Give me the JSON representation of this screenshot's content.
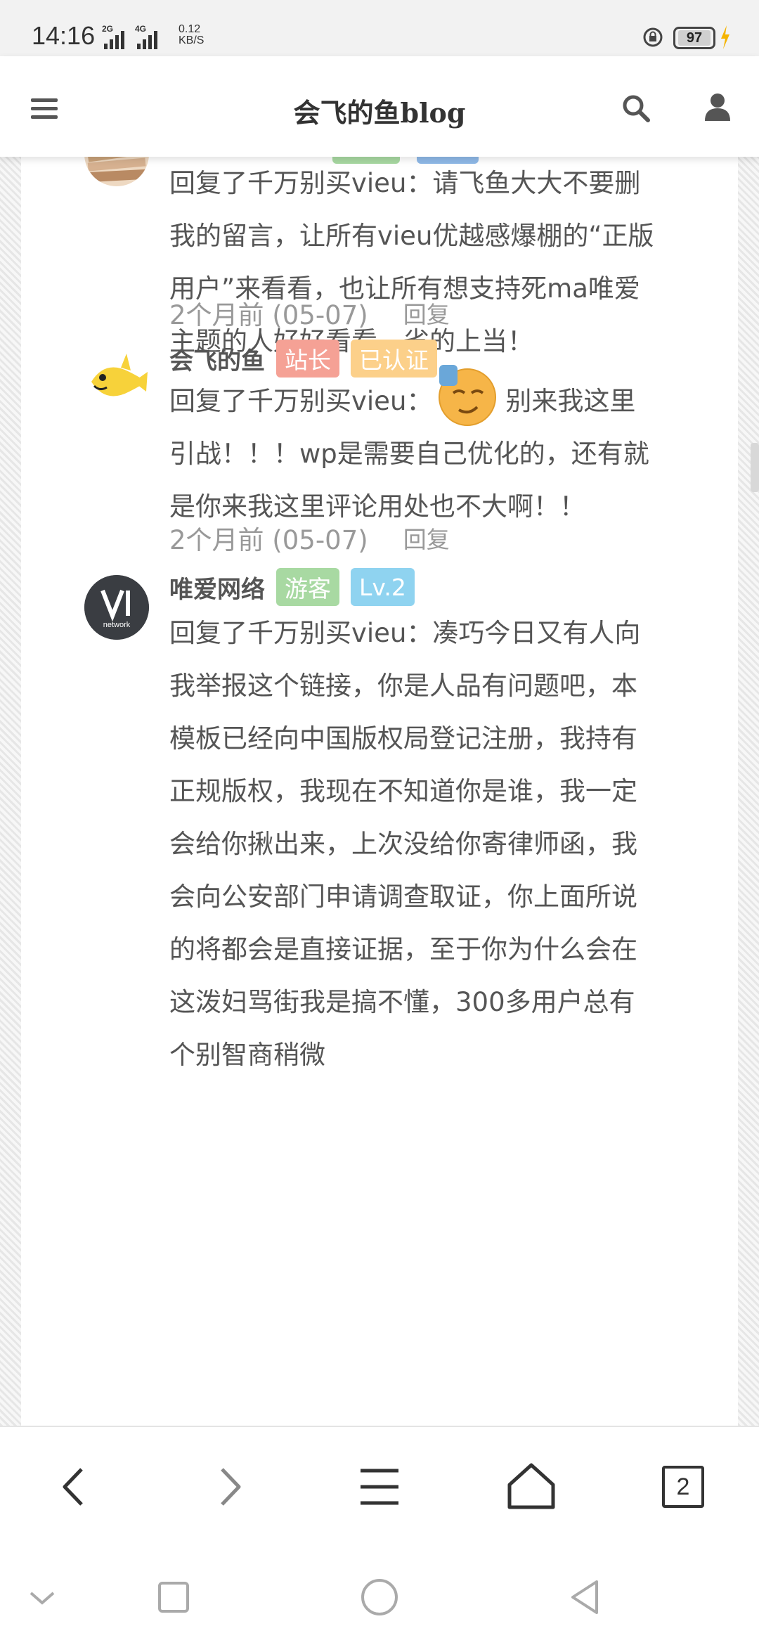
{
  "status_bar": {
    "time": "14:16",
    "net1": "2G",
    "net2": "4G",
    "speed_value": "0.12",
    "speed_unit": "KB/S",
    "battery": "97"
  },
  "header": {
    "site_title": "会飞的鱼blog",
    "icons": [
      "menu-icon",
      "search-icon",
      "user-icon"
    ]
  },
  "comments": [
    {
      "name": "",
      "badges": [],
      "body": "回复了千万别买vieu：请飞鱼大大不要删我的留言，让所有vieu优越感爆棚的“正版用户”来看看，也让所有想支持死ma唯爱主题的人好好看看，省的上当！",
      "time": "2个月前 (05-07)",
      "reply_label": "回复"
    },
    {
      "name": "会飞的鱼",
      "badges": [
        {
          "label": "站长",
          "color": "#f5a195"
        },
        {
          "label": "已认证",
          "color": "#fcd08a"
        }
      ],
      "body_before": "回复了千万别买vieu：",
      "body_after": "别来我这里引战！！！wp是需要自己优化的，还有就是你来我这里评论用处也不大啊！！",
      "emoji": "sweat-smile-emoji",
      "time": "2个月前 (05-07)",
      "reply_label": "回复"
    },
    {
      "name": "唯爱网络",
      "avatar_text": "network",
      "badges": [
        {
          "label": "游客",
          "color": "#a8d9a2"
        },
        {
          "label": "Lv.2",
          "color": "#8fd3f0"
        }
      ],
      "body": "回复了千万别买vieu：凑巧今日又有人向我举报这个链接，你是人品有问题吧，本模板已经向中国版权局登记注册，我持有正规版权，我现在不知道你是谁，我一定会给你揪出来，上次没给你寄律师函，我会向公安部门申请调查取证，你上面所说的将都会是直接证据，至于你为什么会在这泼妇骂街我是搞不懂，300多用户总有个别智商稍微"
    }
  ],
  "browser_bar": {
    "tab_count": "2",
    "icons": [
      "back-icon",
      "forward-icon",
      "menu-icon",
      "home-icon",
      "tabs-icon"
    ]
  },
  "nav_bar": {
    "icons": [
      "collapse-icon",
      "recents-icon",
      "home-circle-icon",
      "back-triangle-icon"
    ]
  },
  "colors": {
    "text": "#555555",
    "meta": "#999999",
    "pattern": "#e6e6e6"
  }
}
